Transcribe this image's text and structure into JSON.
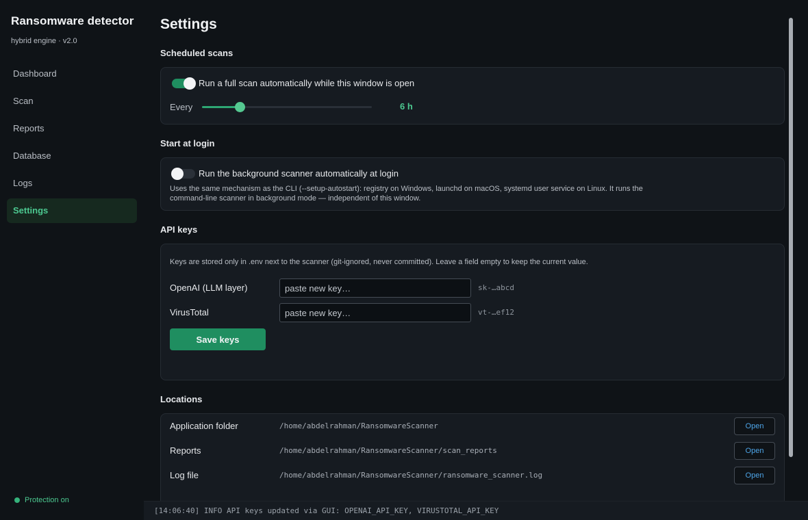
{
  "sidebar": {
    "title": "Ransomware detector",
    "subtitle": "hybrid engine · v2.0",
    "items": [
      {
        "label": "Dashboard"
      },
      {
        "label": "Scan"
      },
      {
        "label": "Reports"
      },
      {
        "label": "Database"
      },
      {
        "label": "Logs"
      },
      {
        "label": "Settings",
        "active": true
      }
    ],
    "status": "Protection on"
  },
  "page": {
    "title": "Settings"
  },
  "scheduled": {
    "section_title": "Scheduled scans",
    "toggle_on": true,
    "toggle_label": "Run a full scan automatically while this window is open",
    "every_label": "Every",
    "interval_hours": 6,
    "interval_fraction": 0.22,
    "interval_display": "6 h"
  },
  "login": {
    "section_title": "Start at login",
    "toggle_on": false,
    "toggle_label": "Run the background scanner automatically at login",
    "note_line1": "Uses the same mechanism as the CLI (--setup-autostart): registry on Windows, launchd on macOS, systemd user service on Linux. It runs the",
    "note_line2": "command-line scanner in background mode — independent of this window."
  },
  "api": {
    "section_title": "API keys",
    "note": "Keys are stored only in .env next to the scanner (git-ignored, never committed). Leave a field empty to keep the current value.",
    "fields": [
      {
        "label": "OpenAI (LLM layer)",
        "placeholder": "paste new key…",
        "value": "",
        "masked": "sk-…abcd"
      },
      {
        "label": "VirusTotal",
        "placeholder": "paste new key…",
        "value": "",
        "masked": "vt-…ef12"
      }
    ],
    "save_label": "Save keys"
  },
  "locations": {
    "section_title": "Locations",
    "rows": [
      {
        "label": "Application folder",
        "path": "/home/abdelrahman/RansomwareScanner",
        "button": "Open"
      },
      {
        "label": "Reports",
        "path": "/home/abdelrahman/RansomwareScanner/scan_reports",
        "button": "Open"
      },
      {
        "label": "Log file",
        "path": "/home/abdelrahman/RansomwareScanner/ransomware_scanner.log",
        "button": "Open"
      }
    ]
  },
  "log": {
    "line": "[14:06:40] INFO  API keys updated via GUI: OPENAI_API_KEY, VIRUSTOTAL_API_KEY"
  },
  "colors": {
    "accent": "#1f8e60",
    "accent_text": "#4cc890",
    "link": "#4ea5e8",
    "background": "#0f1317",
    "card": "#161b21"
  }
}
